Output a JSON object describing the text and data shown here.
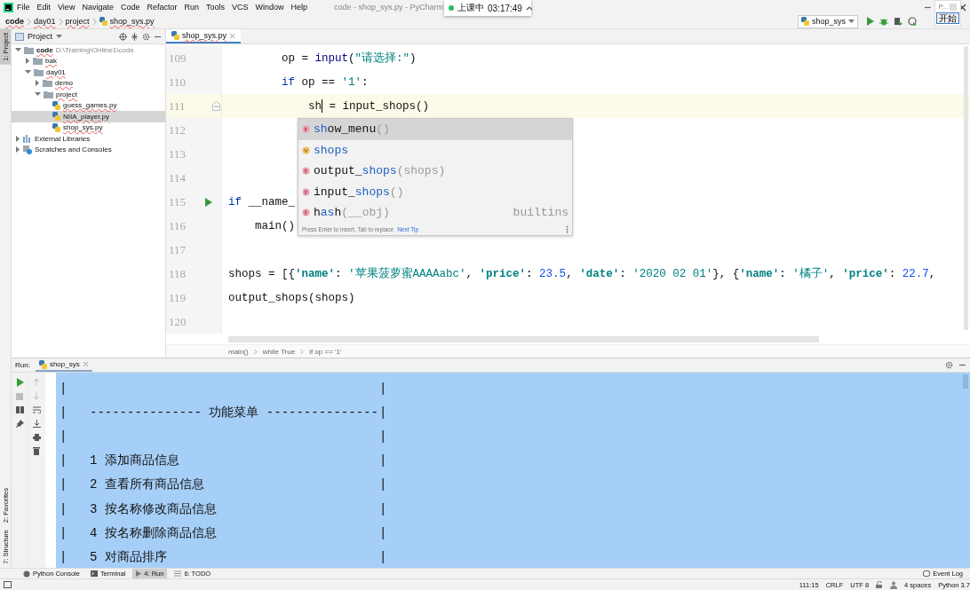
{
  "window": {
    "title": "code - shop_sys.py - PyCharm"
  },
  "menu": [
    "File",
    "Edit",
    "View",
    "Navigate",
    "Code",
    "Refactor",
    "Run",
    "Tools",
    "VCS",
    "Window",
    "Help"
  ],
  "notification": {
    "label": "上课中",
    "time": "03:17:49"
  },
  "recorder_popup": {
    "title": "P...",
    "button": "开始"
  },
  "breadcrumbs": [
    {
      "label": "code",
      "kind": "root"
    },
    {
      "label": "day01",
      "kind": "folder"
    },
    {
      "label": "project",
      "kind": "folder"
    },
    {
      "label": "shop_sys.py",
      "kind": "file"
    }
  ],
  "run_config": {
    "name": "shop_sys"
  },
  "side_tabs": [
    {
      "label": "1: Project",
      "selected": true
    },
    {
      "label": "2: Favorites",
      "selected": false
    },
    {
      "label": "7: Structure",
      "selected": false
    }
  ],
  "project_panel": {
    "title": "Project",
    "tree": [
      {
        "label": "code",
        "path": "D:\\Training\\Online1\\code",
        "kind": "folder",
        "expanded": true,
        "selected": false,
        "children": [
          {
            "label": "bak",
            "kind": "folder",
            "expanded": false,
            "selected": false
          },
          {
            "label": "day01",
            "kind": "folder",
            "expanded": true,
            "selected": false,
            "children": [
              {
                "label": "demo",
                "kind": "folder",
                "expanded": false,
                "selected": false
              },
              {
                "label": "project",
                "kind": "folder",
                "expanded": true,
                "selected": false,
                "children": [
                  {
                    "label": "guess_games.py",
                    "kind": "file",
                    "selected": false
                  },
                  {
                    "label": "NIIA_player.py",
                    "kind": "file",
                    "selected": true
                  },
                  {
                    "label": "shop_sys.py",
                    "kind": "file",
                    "selected": false
                  }
                ]
              }
            ]
          }
        ]
      },
      {
        "label": "External Libraries",
        "kind": "library",
        "expanded": false,
        "selected": false
      },
      {
        "label": "Scratches and Consoles",
        "kind": "scratches",
        "expanded": false,
        "selected": false
      }
    ]
  },
  "editor": {
    "tabs": [
      {
        "label": "shop_sys.py",
        "selected": true
      }
    ],
    "lines": [
      {
        "number": "109",
        "current": false,
        "tokens": [
          {
            "text": "        op = ",
            "kind": "plain"
          },
          {
            "text": "input",
            "kind": "builtin"
          },
          {
            "text": "(",
            "kind": "plain"
          },
          {
            "text": "\"请选择:\"",
            "kind": "string"
          },
          {
            "text": ")",
            "kind": "plain"
          }
        ]
      },
      {
        "number": "110",
        "current": false,
        "tokens": [
          {
            "text": "        if",
            "kind": "keyword"
          },
          {
            "text": " op == ",
            "kind": "plain"
          },
          {
            "text": "'1'",
            "kind": "string"
          },
          {
            "text": ":",
            "kind": "plain"
          }
        ]
      },
      {
        "number": "111",
        "current": true,
        "fold_marker": true,
        "tokens": [
          {
            "text": "            sh",
            "kind": "plain"
          },
          {
            "kind": "caret"
          },
          {
            "text": " = input_shops()",
            "kind": "plain"
          }
        ]
      },
      {
        "number": "112",
        "current": false
      },
      {
        "number": "113",
        "current": false
      },
      {
        "number": "114",
        "current": false
      },
      {
        "number": "115",
        "current": false,
        "run_marker": true,
        "tokens": [
          {
            "text": "if",
            "kind": "keyword"
          },
          {
            "text": " __name_",
            "kind": "plain"
          }
        ]
      },
      {
        "number": "116",
        "current": false,
        "tokens": [
          {
            "text": "    main()",
            "kind": "plain"
          }
        ]
      },
      {
        "number": "117",
        "current": false
      },
      {
        "number": "118",
        "current": false,
        "tokens": [
          {
            "text": "shops = [{",
            "kind": "plain"
          },
          {
            "text": "'name'",
            "kind": "key"
          },
          {
            "text": ": ",
            "kind": "plain"
          },
          {
            "text": "'苹果菠萝蜜AAAAabc'",
            "kind": "string"
          },
          {
            "text": ", ",
            "kind": "plain"
          },
          {
            "text": "'price'",
            "kind": "key"
          },
          {
            "text": ": ",
            "kind": "plain"
          },
          {
            "text": "23.5",
            "kind": "number"
          },
          {
            "text": ", ",
            "kind": "plain"
          },
          {
            "text": "'date'",
            "kind": "key"
          },
          {
            "text": ": ",
            "kind": "plain"
          },
          {
            "text": "'2020 02 01'",
            "kind": "string"
          },
          {
            "text": "}, {",
            "kind": "plain"
          },
          {
            "text": "'name'",
            "kind": "key"
          },
          {
            "text": ": ",
            "kind": "plain"
          },
          {
            "text": "'橘子'",
            "kind": "string"
          },
          {
            "text": ", ",
            "kind": "plain"
          },
          {
            "text": "'price'",
            "kind": "key"
          },
          {
            "text": ": ",
            "kind": "plain"
          },
          {
            "text": "22.7",
            "kind": "number"
          },
          {
            "text": ",",
            "kind": "plain"
          }
        ]
      },
      {
        "number": "119",
        "current": false,
        "tokens": [
          {
            "text": "output_shops(shops)",
            "kind": "plain"
          }
        ]
      },
      {
        "number": "120",
        "current": false
      }
    ],
    "completion": {
      "items": [
        {
          "kind": "function",
          "selected": true,
          "parts": [
            {
              "text": "sh",
              "match": true
            },
            {
              "text": "ow_menu",
              "match": false
            }
          ],
          "params": "()"
        },
        {
          "kind": "variable",
          "selected": false,
          "parts": [
            {
              "text": "shops",
              "match": true
            }
          ]
        },
        {
          "kind": "function",
          "selected": false,
          "parts": [
            {
              "text": "output_",
              "match": false
            },
            {
              "text": "shops",
              "match": true
            }
          ],
          "params": "(shops)"
        },
        {
          "kind": "function",
          "selected": false,
          "parts": [
            {
              "text": "input_",
              "match": false
            },
            {
              "text": "shops",
              "match": true
            }
          ],
          "params": "()"
        },
        {
          "kind": "function",
          "selected": false,
          "parts": [
            {
              "text": "h",
              "match": false
            },
            {
              "text": "as",
              "match": true
            },
            {
              "text": "h",
              "match": false
            }
          ],
          "params": "(__obj)",
          "source": "builtins"
        }
      ],
      "hint": "Press Enter to insert, Tab to replace",
      "hint_link": "Next Tip"
    },
    "breadcrumbs": [
      "main()",
      "while True",
      "if op == '1'"
    ]
  },
  "run_panel": {
    "label": "Run:",
    "tabs": [
      {
        "label": "shop_sys",
        "selected": true
      }
    ],
    "lines": [
      {
        "left": "|",
        "right": "|"
      },
      {
        "left": "|",
        "text": "--------------- 功能菜单 ---------------",
        "right": "|"
      },
      {
        "left": "|",
        "right": "|"
      },
      {
        "left": "|",
        "text": "1 添加商品信息",
        "right": "|"
      },
      {
        "left": "|",
        "text": "2 查看所有商品信息",
        "right": "|"
      },
      {
        "left": "|",
        "text": "3 按名称修改商品信息",
        "right": "|"
      },
      {
        "left": "|",
        "text": "4 按名称删除商品信息",
        "right": "|"
      },
      {
        "left": "|",
        "text": "5 对商品排序",
        "right": "|"
      }
    ]
  },
  "tool_windows": {
    "tabs": [
      {
        "label": "Python Console",
        "kind": "python",
        "selected": false
      },
      {
        "label": "Terminal",
        "kind": "terminal",
        "selected": false
      },
      {
        "label": "4: Run",
        "kind": "run",
        "selected": true
      },
      {
        "label": "6: TODO",
        "kind": "todo",
        "selected": false
      }
    ],
    "event_log": "Event Log"
  },
  "status_bar": {
    "position": "111:15",
    "line_separator": "CRLF",
    "encoding": "UTF 8",
    "indent": "4 spaces",
    "interpreter": "Python 3.7"
  }
}
